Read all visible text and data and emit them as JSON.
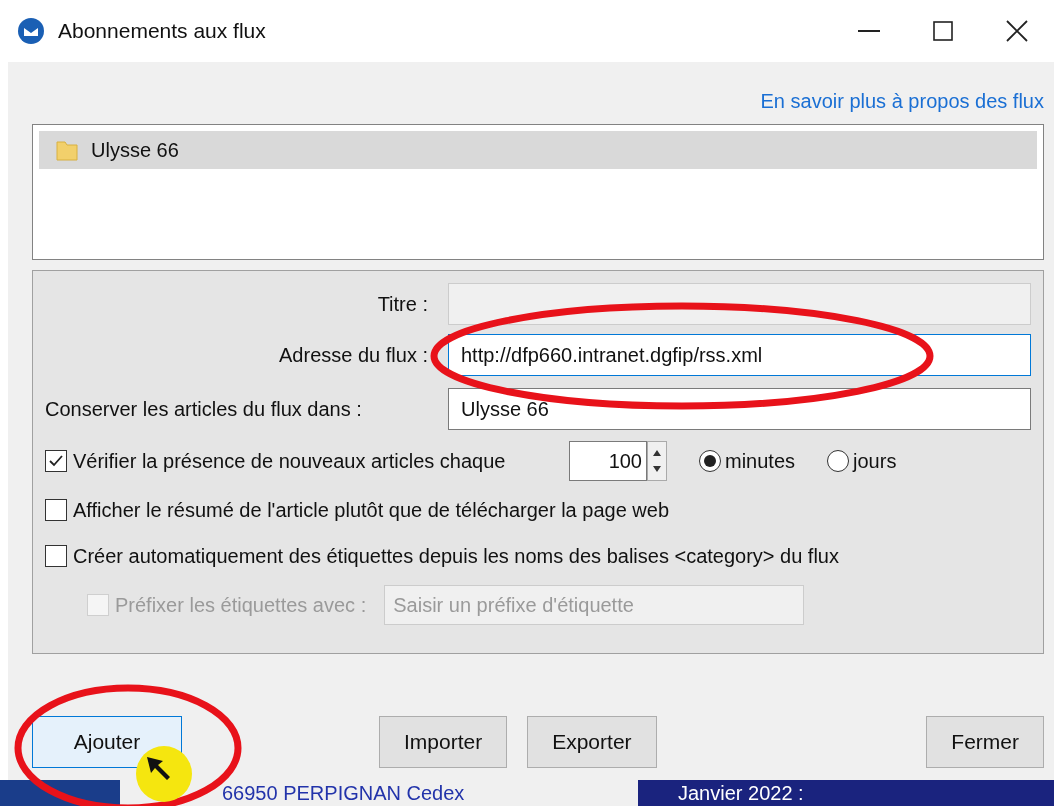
{
  "window": {
    "title": "Abonnements aux flux"
  },
  "help_link": "En savoir plus à propos des flux",
  "feeds": [
    {
      "name": "Ulysse 66",
      "selected": true
    }
  ],
  "form": {
    "title_label": "Titre :",
    "title_disabled": true,
    "address_label": "Adresse du flux :",
    "address_value": "http://dfp660.intranet.dgfip/rss.xml",
    "folder_label": "Conserver les articles du flux dans :",
    "folder_value": "Ulysse 66",
    "check_label": "Vérifier la présence de nouveaux articles chaque",
    "check_checked": true,
    "interval": "100",
    "units": [
      {
        "label": "minutes",
        "selected": true
      },
      {
        "label": "jours",
        "selected": false
      }
    ],
    "options": [
      {
        "label": "Afficher le résumé de l'article plutôt que de télécharger la page web",
        "checked": false,
        "disabled": false
      },
      {
        "label": "Créer automatiquement des étiquettes depuis les noms des balises <category> du flux",
        "checked": false,
        "disabled": false
      }
    ],
    "prefix_label": "Préfixer les étiquettes avec :",
    "prefix_checked": false,
    "prefix_disabled": true,
    "prefix_placeholder": "Saisir un préfixe d'étiquette"
  },
  "buttons": [
    {
      "label": "Ajouter",
      "focused": true
    },
    {
      "label": "Importer",
      "focused": false
    },
    {
      "label": "Exporter",
      "focused": false
    },
    {
      "label": "Fermer",
      "focused": false
    }
  ],
  "background": {
    "address": "66950 PERPIGNAN Cedex",
    "date": "Janvier 2022 :"
  }
}
